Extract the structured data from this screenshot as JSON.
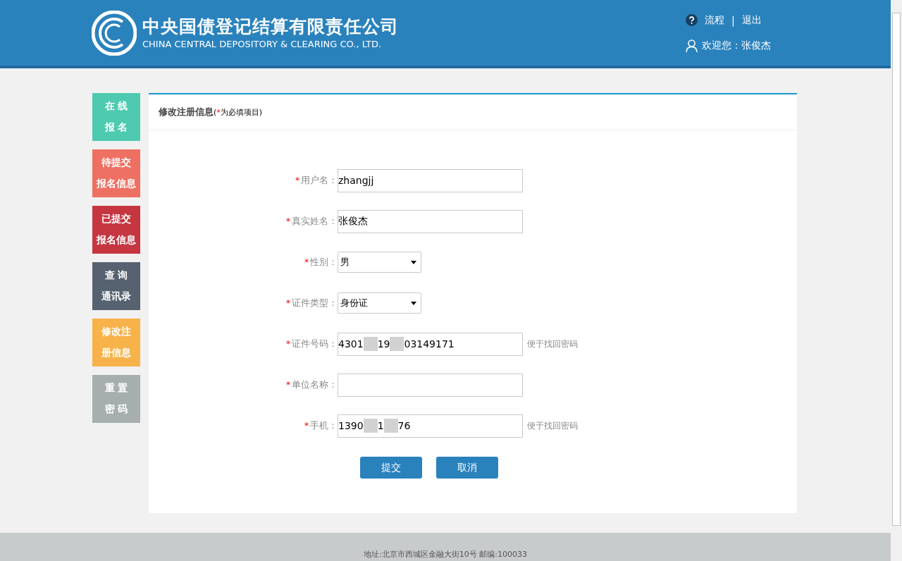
{
  "header": {
    "logo_cn": "中央国债登记结算有限责任公司",
    "logo_en": "CHINA CENTRAL DEPOSITORY & CLEARING CO., LTD.",
    "links": [
      "流程",
      "退出"
    ],
    "separator": "|",
    "welcome": "欢迎您：张俊杰"
  },
  "sidebar": {
    "items": [
      {
        "lines": [
          "在 线",
          "报 名"
        ],
        "color": "#4ecab0"
      },
      {
        "lines": [
          "待提交",
          "报名信息"
        ],
        "color": "#ee7063"
      },
      {
        "lines": [
          "已提交",
          "报名信息"
        ],
        "color": "#c53641"
      },
      {
        "lines": [
          "查 询",
          "通讯录"
        ],
        "color": "#566270"
      },
      {
        "lines": [
          "修改注",
          "册信息"
        ],
        "color": "#f7b24a"
      },
      {
        "lines": [
          "重 置",
          "密 码"
        ],
        "color": "#a6aeae"
      }
    ]
  },
  "panel": {
    "title": "修改注册信息",
    "note_parts": [
      "(",
      "*",
      "为必填项目)"
    ],
    "fields": [
      {
        "kind": "text",
        "mark": "*",
        "label": "用户名：",
        "value_parts": [
          "zhangjj"
        ]
      },
      {
        "kind": "text",
        "mark": "*",
        "label": "真实姓名：",
        "value_parts": [
          "张俊杰"
        ]
      },
      {
        "kind": "select",
        "mark": "*",
        "label": "性别：",
        "value_parts": [
          "男"
        ]
      },
      {
        "kind": "select",
        "mark": "*",
        "label": "证件类型：",
        "value_parts": [
          "身份证"
        ]
      },
      {
        "kind": "text",
        "mark": "*",
        "label": "证件号码：",
        "value_parts": [
          "4301",
          "19",
          "03149171"
        ],
        "hint": "便于找回密码"
      },
      {
        "kind": "text",
        "mark": "*",
        "label": "单位名称："
      },
      {
        "kind": "text",
        "mark": "*",
        "label": "手机：",
        "value_parts": [
          "1390",
          "1",
          "76"
        ],
        "hint": "便于找回密码"
      }
    ],
    "buttons": [
      "提交",
      "取消"
    ]
  },
  "footer": {
    "address": "地址:北京市西城区金融大街10号 邮编:100033"
  }
}
